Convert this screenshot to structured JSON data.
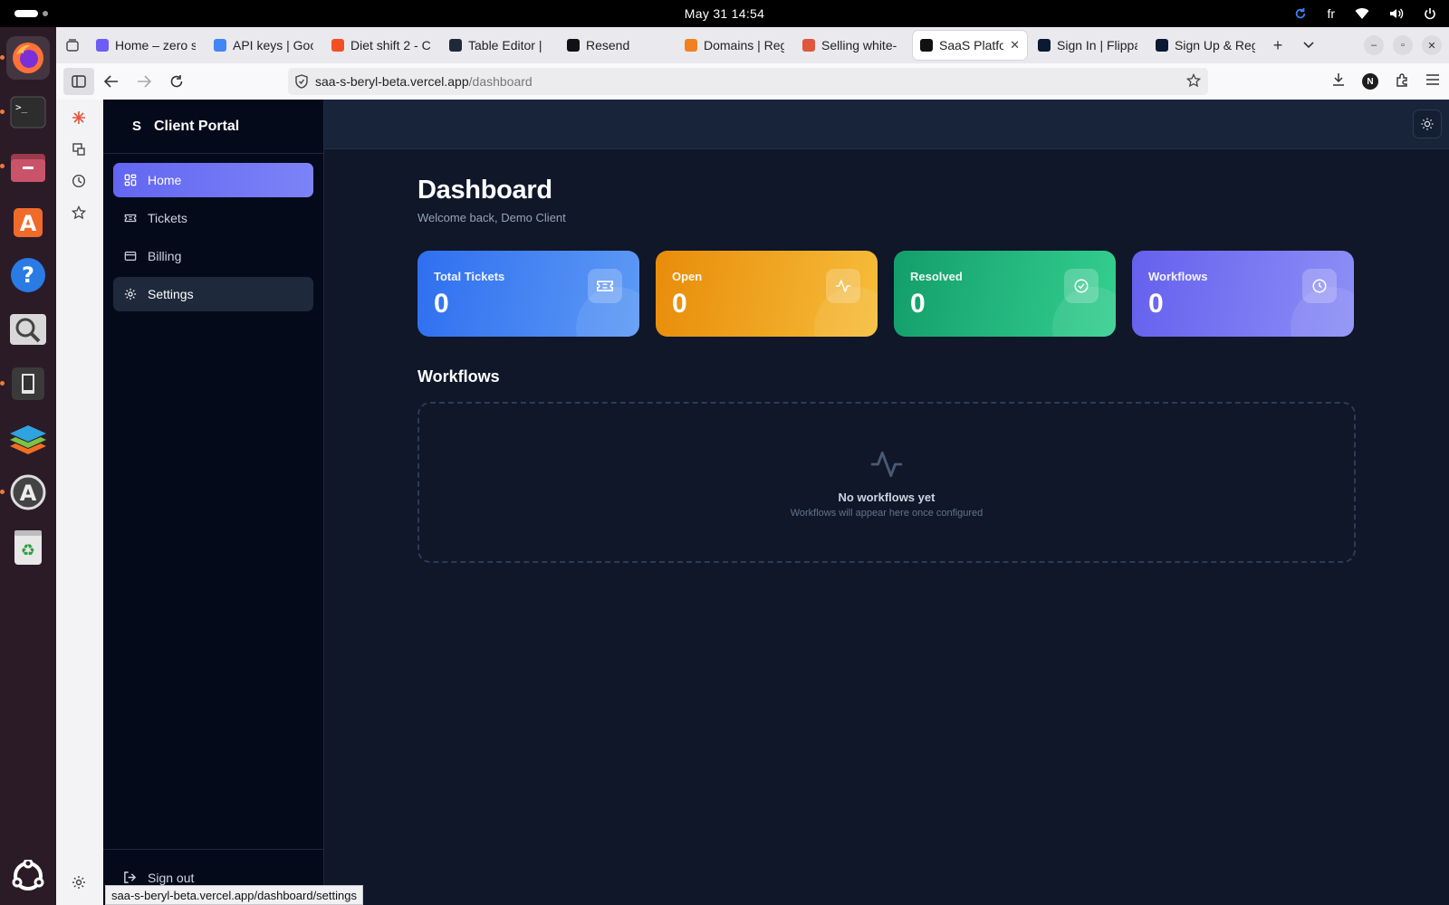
{
  "topbar": {
    "clock": "May 31  14:54",
    "lang": "fr"
  },
  "dock": {
    "items": [
      {
        "name": "firefox-icon"
      },
      {
        "name": "terminal-icon"
      },
      {
        "name": "files-icon"
      },
      {
        "name": "app-center-icon"
      },
      {
        "name": "help-icon"
      },
      {
        "name": "image-viewer-icon"
      },
      {
        "name": "device-icon"
      },
      {
        "name": "layers-icon"
      },
      {
        "name": "software-updater-icon"
      },
      {
        "name": "trash-icon"
      }
    ]
  },
  "browser": {
    "tabs": [
      {
        "label": "Home – zero s",
        "color": "#6d5cf6"
      },
      {
        "label": "API keys | Goo",
        "color": "#4285f4"
      },
      {
        "label": "Diet shift 2 - C",
        "color": "#f25022"
      },
      {
        "label": "Table Editor |",
        "color": "#1f2937"
      },
      {
        "label": "Resend",
        "color": "#111111"
      },
      {
        "label": "Domains | Reg",
        "color": "#f38020"
      },
      {
        "label": "Selling white-",
        "color": "#e0573f"
      },
      {
        "label": "SaaS Platfo",
        "color": "#111111",
        "active": true
      },
      {
        "label": "Sign In | Flippa",
        "color": "#0b1a33"
      },
      {
        "label": "Sign Up & Reg",
        "color": "#0b1a33"
      }
    ],
    "url_host": "saa-s-beryl-beta.vercel.app",
    "url_path": "/dashboard",
    "profile_initial": "N",
    "status_url": "saa-s-beryl-beta.vercel.app/dashboard/settings"
  },
  "app": {
    "logo_letter": "S",
    "brand": "Client Portal",
    "nav": [
      {
        "label": "Home",
        "icon": "grid-icon",
        "state": "active"
      },
      {
        "label": "Tickets",
        "icon": "ticket-icon",
        "state": ""
      },
      {
        "label": "Billing",
        "icon": "credit-card-icon",
        "state": ""
      },
      {
        "label": "Settings",
        "icon": "gear-icon",
        "state": "hover"
      }
    ],
    "sign_out": "Sign out",
    "title": "Dashboard",
    "subtitle": "Welcome back, Demo Client",
    "stats": [
      {
        "label": "Total Tickets",
        "value": "0",
        "icon": "ticket-icon",
        "color": "#2f6ff0"
      },
      {
        "label": "Open",
        "value": "0",
        "icon": "activity-icon",
        "color": "#e88c0a"
      },
      {
        "label": "Resolved",
        "value": "0",
        "icon": "check-circle-icon",
        "color": "#139e6b"
      },
      {
        "label": "Workflows",
        "value": "0",
        "icon": "clock-icon",
        "color": "#6660ee"
      }
    ],
    "workflows_title": "Workflows",
    "empty_title": "No workflows yet",
    "empty_sub": "Workflows will appear here once configured"
  }
}
